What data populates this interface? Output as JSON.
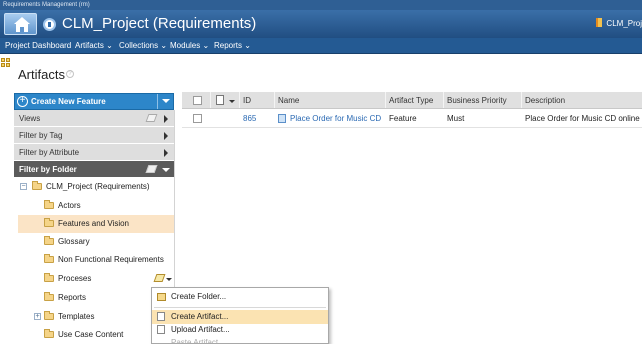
{
  "app": {
    "window_title": "Requirements Management (rm)",
    "project_title": "CLM_Project (Requirements)",
    "project_switcher": "CLM_Proj"
  },
  "menu": [
    {
      "label": "Project Dashboard"
    },
    {
      "label": "Artifacts ⌄"
    },
    {
      "label": "Collections ⌄"
    },
    {
      "label": "Modules ⌄"
    },
    {
      "label": "Reports ⌄"
    }
  ],
  "page": {
    "title": "Artifacts",
    "help": "?"
  },
  "left_panel": {
    "create_button": "Create New Feature",
    "sections": [
      {
        "label": "Views"
      },
      {
        "label": "Filter by Tag"
      },
      {
        "label": "Filter by Attribute"
      }
    ],
    "folder_section": "Filter by Folder",
    "tree": {
      "root": "CLM_Project (Requirements)",
      "root_toggle": "−",
      "templates_toggle": "+",
      "folders": [
        {
          "label": "Actors"
        },
        {
          "label": "Features and Vision",
          "selected": true
        },
        {
          "label": "Glossary"
        },
        {
          "label": "Non Functional Requirements"
        },
        {
          "label": "Proceses"
        },
        {
          "label": "Reports"
        },
        {
          "label": "Templates"
        },
        {
          "label": "Use Case Content"
        }
      ]
    }
  },
  "grid": {
    "columns": [
      {
        "label": ""
      },
      {
        "label": ""
      },
      {
        "label": "ID"
      },
      {
        "label": "Name"
      },
      {
        "label": "Artifact Type"
      },
      {
        "label": "Business Priority"
      },
      {
        "label": "Description"
      }
    ],
    "rows": [
      {
        "id": "865",
        "name": "Place Order for Music CD",
        "type": "Feature",
        "priority": "Must",
        "description": "Place Order for Music CD online"
      }
    ]
  },
  "context_menu": {
    "items": [
      {
        "label": "Create Folder..."
      },
      {
        "label": "Create Artifact...",
        "active": true
      },
      {
        "label": "Upload Artifact..."
      },
      {
        "label": "Paste Artifact",
        "disabled": true
      }
    ]
  },
  "colors": {
    "banner": "#2a5c94",
    "accent_button": "#2d86c9",
    "selection": "#fbe4c6",
    "link": "#2a69b3"
  }
}
